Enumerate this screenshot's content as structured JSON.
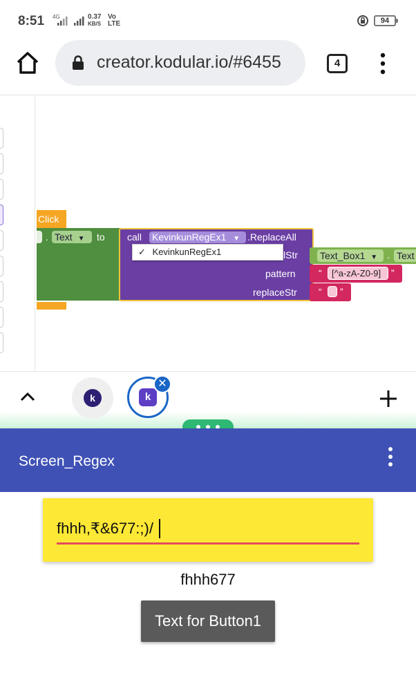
{
  "status_bar": {
    "time": "8:51",
    "network_small": "4G",
    "speed_value": "0.37",
    "speed_unit": "KB/S",
    "carrier_top": "Vo",
    "carrier_bottom": "LTE",
    "battery": "94"
  },
  "browser": {
    "url": "creator.kodular.io/#6455",
    "tabs_count": "4"
  },
  "blocks": {
    "event_label": "Click",
    "setter_dot": ".",
    "setter_property": "Text",
    "to_label": "to",
    "call_label": "call",
    "component": "KevinkunRegEx1",
    "method": ".ReplaceAll",
    "dropdown_option": "KevinkunRegEx1",
    "dropdown_check": "✓",
    "slot_str": "lStr",
    "slot_pattern": "pattern",
    "slot_replace": "replaceStr",
    "textbox_component": "Text_Box1",
    "textbox_dot": ".",
    "textbox_property": "Text",
    "pattern_value": "[^a-zA-Z0-9]",
    "quote_open": "“",
    "quote_close": "”"
  },
  "switcher": {
    "logo_letter": "k",
    "close_symbol": "✕"
  },
  "app": {
    "screen_title": "Screen_Regex",
    "textbox_value": "fhhh,₹&677:;)/",
    "result_label": "fhhh677",
    "button_label": "Text for Button1"
  },
  "colors": {
    "app_header": "#3f51b5",
    "textbox_bg": "#fde835",
    "procedure_purple": "#6a3ea3",
    "event_green": "#4f8f3f",
    "string_pink": "#d3275f",
    "accent_blue": "#1a66c6",
    "handle_green": "#2fb873"
  }
}
